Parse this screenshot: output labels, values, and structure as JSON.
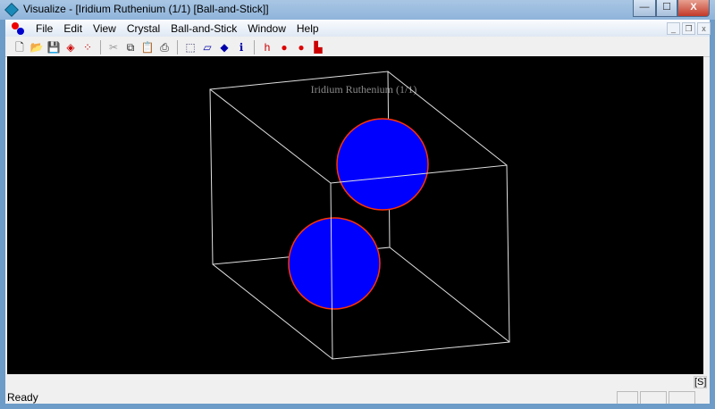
{
  "window": {
    "title": "Visualize - [Iridium Ruthenium (1/1) [Ball-and-Stick]]",
    "minimize": "—",
    "maximize": "☐",
    "close": "X"
  },
  "menu": [
    "File",
    "Edit",
    "View",
    "Crystal",
    "Ball-and-Stick",
    "Window",
    "Help"
  ],
  "mdi": {
    "minimize": "_",
    "restore": "❐",
    "close": "x"
  },
  "toolbar": [
    {
      "name": "new-icon",
      "glyph": "🗋"
    },
    {
      "name": "open-icon",
      "glyph": "📂"
    },
    {
      "name": "save-icon",
      "glyph": "💾"
    },
    {
      "name": "delete-crystal-icon",
      "glyph": "◈"
    },
    {
      "name": "delete-atoms-icon",
      "glyph": "⁘"
    },
    {
      "name": "cut-icon",
      "glyph": "✂"
    },
    {
      "name": "copy-icon",
      "glyph": "⧉"
    },
    {
      "name": "paste-icon",
      "glyph": "📋"
    },
    {
      "name": "print-icon",
      "glyph": "⎙"
    },
    {
      "name": "cell-icon",
      "glyph": "⬚"
    },
    {
      "name": "plane-icon",
      "glyph": "▱"
    },
    {
      "name": "center-icon",
      "glyph": "◆"
    },
    {
      "name": "info-icon",
      "glyph": "ℹ"
    },
    {
      "name": "hkl-icon",
      "glyph": "h"
    },
    {
      "name": "bond-icon",
      "glyph": "●"
    },
    {
      "name": "atom-icon",
      "glyph": "●"
    },
    {
      "name": "histogram-icon",
      "glyph": "▙"
    }
  ],
  "viewport": {
    "label": "Iridium Ruthenium (1/1)",
    "atom_color": "#0000ff",
    "atom_outline": "#ff3300"
  },
  "status": {
    "text": "Ready",
    "indicator": "[S]"
  }
}
